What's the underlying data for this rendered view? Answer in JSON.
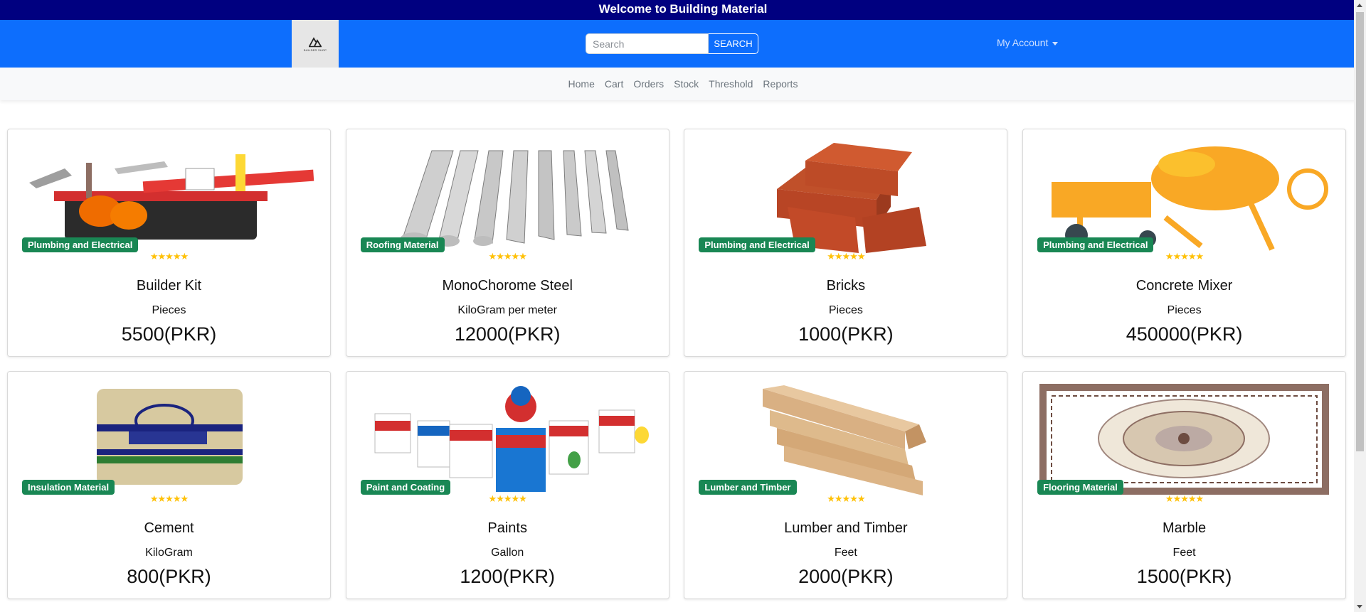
{
  "topbar": {
    "title": "Welcome to Building Material"
  },
  "header": {
    "logo_text": "BUILDER SHOP",
    "search": {
      "placeholder": "Search",
      "value": "",
      "button_label": "SEARCH"
    },
    "account_label": "My Account"
  },
  "nav": {
    "items": [
      "Home",
      "Cart",
      "Orders",
      "Stock",
      "Threshold",
      "Reports"
    ]
  },
  "products": [
    {
      "name": "Builder Kit",
      "unit": "Pieces",
      "price": "5500(PKR)",
      "category": "Plumbing and Electrical",
      "rating": "★★★★★",
      "image_icon": "toolbox-image"
    },
    {
      "name": "MonoChorome Steel",
      "unit": "KiloGram per meter",
      "price": "12000(PKR)",
      "category": "Roofing Material",
      "rating": "★★★★★",
      "image_icon": "steel-rods-image"
    },
    {
      "name": "Bricks",
      "unit": "Pieces",
      "price": "1000(PKR)",
      "category": "Plumbing and Electrical",
      "rating": "★★★★★",
      "image_icon": "bricks-image"
    },
    {
      "name": "Concrete Mixer",
      "unit": "Pieces",
      "price": "450000(PKR)",
      "category": "Plumbing and Electrical",
      "rating": "★★★★★",
      "image_icon": "concrete-mixer-image"
    },
    {
      "name": "Cement",
      "unit": "KiloGram",
      "price": "800(PKR)",
      "category": "Insulation Material",
      "rating": "★★★★★",
      "image_icon": "cement-bag-image"
    },
    {
      "name": "Paints",
      "unit": "Gallon",
      "price": "1200(PKR)",
      "category": "Paint and Coating",
      "rating": "★★★★★",
      "image_icon": "paint-cans-image"
    },
    {
      "name": "Lumber and Timber",
      "unit": "Feet",
      "price": "2000(PKR)",
      "category": "Lumber and Timber",
      "rating": "★★★★★",
      "image_icon": "timber-planks-image"
    },
    {
      "name": "Marble",
      "unit": "Feet",
      "price": "1500(PKR)",
      "category": "Flooring Material",
      "rating": "★★★★★",
      "image_icon": "marble-pattern-image"
    }
  ],
  "colors": {
    "topbar": "#000080",
    "header": "#0d6efd",
    "badge": "#198754",
    "stars": "#ffc107"
  }
}
